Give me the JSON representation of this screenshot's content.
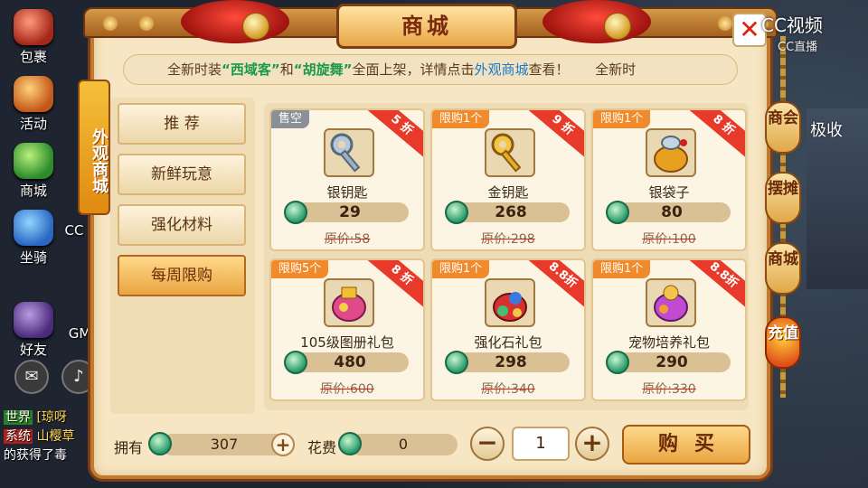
{
  "watermark": {
    "line1": "CC视频",
    "line2": "CC直播"
  },
  "left_icons": [
    {
      "label": "包裹",
      "color": "r"
    },
    {
      "label": "活动",
      "color": ""
    },
    {
      "label": "商城",
      "color": "g"
    },
    {
      "label": "坐骑",
      "color": "b"
    }
  ],
  "left_icons_extra": {
    "label": "CC"
  },
  "friends": {
    "label": "好友",
    "gm": "GM"
  },
  "chat": [
    {
      "tag": "世界",
      "text": "[琼呀"
    },
    {
      "tag": "系统",
      "text": "山樱草"
    },
    {
      "tag": "",
      "text": "的获得了毒"
    }
  ],
  "shop": {
    "title": "商城",
    "notice": {
      "pre": "全新时装",
      "item1": "“西域客”",
      "mid": "和",
      "item2": "“胡旋舞”",
      "mid2": "全面上架，详情点击",
      "link": "外观商城",
      "post": "查看！",
      "tail": "全新时"
    },
    "side_tab": "外观商城",
    "categories": [
      {
        "label": "推 荐"
      },
      {
        "label": "新鲜玩意"
      },
      {
        "label": "强化材料"
      },
      {
        "label": "每周限购"
      }
    ],
    "items": [
      {
        "badge": "售空",
        "discount": "5 折",
        "name": "银钥匙",
        "price": "29",
        "orig": "原价:58",
        "icon": "silver-key-icon"
      },
      {
        "badge": "限购1个",
        "discount": "9 折",
        "name": "金钥匙",
        "price": "268",
        "orig": "原价:298",
        "icon": "gold-key-icon"
      },
      {
        "badge": "限购1个",
        "discount": "8 折",
        "name": "银袋子",
        "price": "80",
        "orig": "原价:100",
        "icon": "silver-bag-icon"
      },
      {
        "badge": "限购5个",
        "discount": "8 折",
        "name": "105级图册礼包",
        "price": "480",
        "orig": "原价:600",
        "icon": "album-gift-icon"
      },
      {
        "badge": "限购1个",
        "discount": "8.8折",
        "name": "强化石礼包",
        "price": "298",
        "orig": "原价:340",
        "icon": "stone-gift-icon"
      },
      {
        "badge": "限购1个",
        "discount": "8.8折",
        "name": "宠物培养礼包",
        "price": "290",
        "orig": "原价:330",
        "icon": "pet-gift-icon"
      }
    ],
    "bottom": {
      "own_label": "拥有",
      "own_value": "307",
      "cost_label": "花费",
      "cost_value": "0",
      "quantity": "1",
      "buy_label": "购买"
    }
  },
  "right_tabs": [
    "商会",
    "摆摊",
    "商城",
    "充值"
  ],
  "right_bg_text": "极收"
}
